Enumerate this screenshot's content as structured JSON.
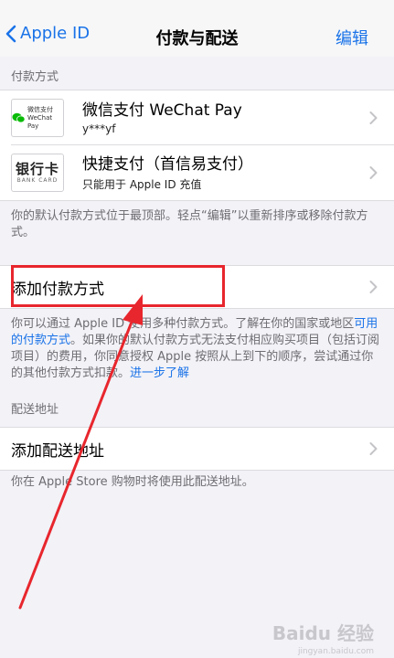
{
  "nav": {
    "back_label": "Apple ID",
    "title": "付款与配送",
    "edit_label": "编辑"
  },
  "payment": {
    "section_header": "付款方式",
    "methods": [
      {
        "logo_text_1": "微信支付",
        "logo_text_2": "WeChat Pay",
        "title": "微信支付 WeChat Pay",
        "subtitle": "y***yf"
      },
      {
        "logo_text_1": "银行卡",
        "logo_text_2": "BANK CARD",
        "title": "快捷支付（首信易支付）",
        "subtitle": "只能用于 Apple ID 充值"
      }
    ],
    "note": "你的默认付款方式位于最顶部。轻点“编辑”以重新排序或移除付款方式。",
    "add_label": "添加付款方式",
    "info_1": "你可以通过 Apple ID 使用多种付款方式。了解在你的国家或地区",
    "info_link": "可用的付款方式",
    "info_2": "。如果你的默认付款方式无法支付相应购买项目（包括订阅项目）的费用，你同意授权 Apple 按照从上到下的顺序，尝试通过你的其他付款方式扣款。",
    "info_more": "进一步了解"
  },
  "shipping": {
    "section_header": "配送地址",
    "add_label": "添加配送地址",
    "note": "你在 Apple Store 购物时将使用此配送地址。"
  },
  "watermark": {
    "text": "Baidu 经验",
    "sub": "jingyan.baidu.com"
  },
  "colors": {
    "accent": "#1a73e8",
    "background": "#f2f2f7",
    "highlight": "#e8262d",
    "wechat_green": "#09bb07"
  }
}
